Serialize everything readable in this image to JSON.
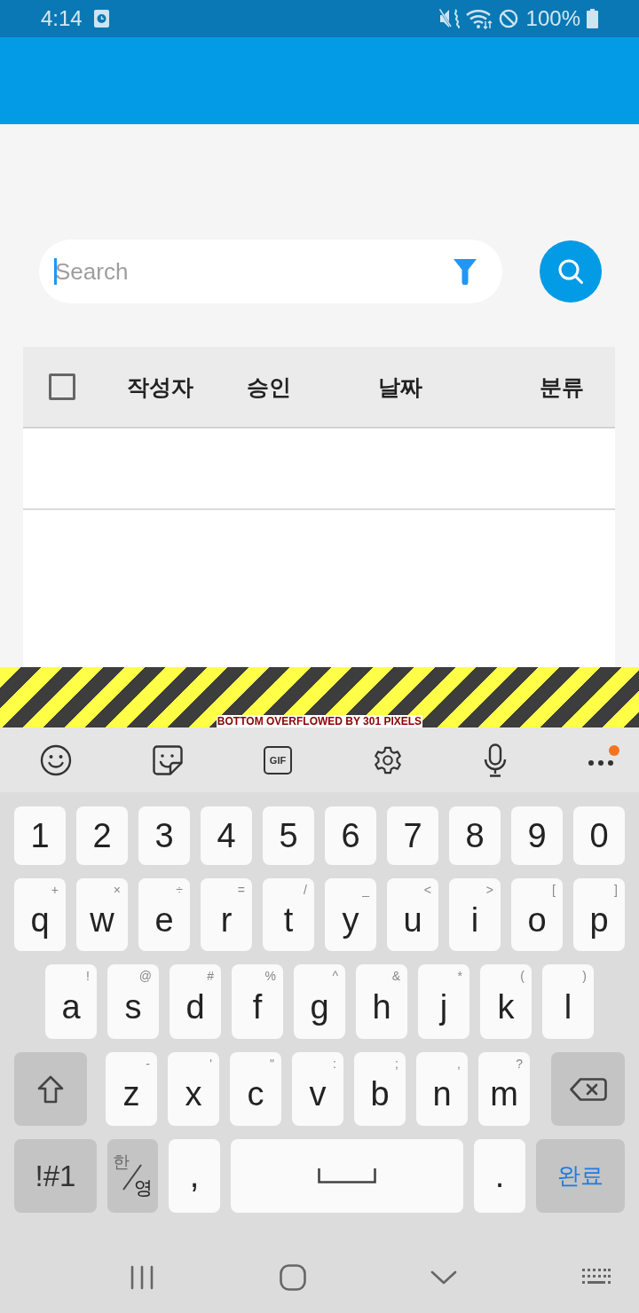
{
  "status_bar": {
    "time": "4:14",
    "battery": "100%"
  },
  "search": {
    "placeholder": "Search",
    "focused": true
  },
  "table": {
    "select_all_checked": false,
    "columns": [
      "작성자",
      "승인",
      "날짜",
      "분류"
    ]
  },
  "overflow_warning": {
    "text": "BOTTOM OVERFLOWED BY 301 PIXELS"
  },
  "keyboard": {
    "toolbar": {
      "gif_label": "GIF",
      "more_badge": true
    },
    "rows": [
      [
        {
          "kind": "char",
          "label": "1"
        },
        {
          "kind": "char",
          "label": "2"
        },
        {
          "kind": "char",
          "label": "3"
        },
        {
          "kind": "char",
          "label": "4"
        },
        {
          "kind": "char",
          "label": "5"
        },
        {
          "kind": "char",
          "label": "6"
        },
        {
          "kind": "char",
          "label": "7"
        },
        {
          "kind": "char",
          "label": "8"
        },
        {
          "kind": "char",
          "label": "9"
        },
        {
          "kind": "char",
          "label": "0"
        }
      ],
      [
        {
          "kind": "char",
          "label": "q",
          "hint": "+"
        },
        {
          "kind": "char",
          "label": "w",
          "hint": "×"
        },
        {
          "kind": "char",
          "label": "e",
          "hint": "÷"
        },
        {
          "kind": "char",
          "label": "r",
          "hint": "="
        },
        {
          "kind": "char",
          "label": "t",
          "hint": "/"
        },
        {
          "kind": "char",
          "label": "y",
          "hint": "_"
        },
        {
          "kind": "char",
          "label": "u",
          "hint": "<"
        },
        {
          "kind": "char",
          "label": "i",
          "hint": ">"
        },
        {
          "kind": "char",
          "label": "o",
          "hint": "["
        },
        {
          "kind": "char",
          "label": "p",
          "hint": "]"
        }
      ],
      [
        {
          "kind": "char",
          "label": "a",
          "hint": "!"
        },
        {
          "kind": "char",
          "label": "s",
          "hint": "@"
        },
        {
          "kind": "char",
          "label": "d",
          "hint": "#"
        },
        {
          "kind": "char",
          "label": "f",
          "hint": "%"
        },
        {
          "kind": "char",
          "label": "g",
          "hint": "^"
        },
        {
          "kind": "char",
          "label": "h",
          "hint": "&"
        },
        {
          "kind": "char",
          "label": "j",
          "hint": "*"
        },
        {
          "kind": "char",
          "label": "k",
          "hint": "("
        },
        {
          "kind": "char",
          "label": "l",
          "hint": ")"
        }
      ],
      [
        {
          "kind": "shift"
        },
        {
          "kind": "char",
          "label": "z",
          "hint": "-"
        },
        {
          "kind": "char",
          "label": "x",
          "hint": "'"
        },
        {
          "kind": "char",
          "label": "c",
          "hint": "\""
        },
        {
          "kind": "char",
          "label": "v",
          "hint": ":"
        },
        {
          "kind": "char",
          "label": "b",
          "hint": ";"
        },
        {
          "kind": "char",
          "label": "n",
          "hint": ","
        },
        {
          "kind": "char",
          "label": "m",
          "hint": "?"
        },
        {
          "kind": "backspace"
        }
      ],
      [
        {
          "kind": "symbols",
          "label": "!#1"
        },
        {
          "kind": "lang",
          "options": [
            {
              "label": "한",
              "selected": false
            },
            {
              "label": "영",
              "selected": true
            }
          ]
        },
        {
          "kind": "char",
          "label": ","
        },
        {
          "kind": "space"
        },
        {
          "kind": "char",
          "label": "."
        },
        {
          "kind": "done",
          "label": "완료"
        }
      ]
    ]
  }
}
